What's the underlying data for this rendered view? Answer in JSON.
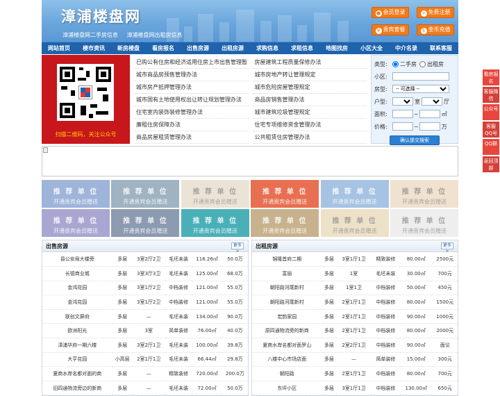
{
  "header": {
    "title": "漳浦楼盘网",
    "subtitles": [
      "漳浦楼盘网二手房信息",
      "漳浦楼盘网出租房信息"
    ],
    "buttons": [
      "会员登录",
      "免费注册",
      "贵宾套餐",
      "金币充值"
    ]
  },
  "nav": [
    "网站首页",
    "楼市资讯",
    "新房楼盘",
    "看房报名",
    "出售房源",
    "出租房源",
    "求购信息",
    "求租信息",
    "地图找房",
    "小区大全",
    "中介名录",
    "联系客服"
  ],
  "qr": {
    "caption": "扫描二维码，关注公众号"
  },
  "links": {
    "left": [
      "已购公有住房和经济适用住房上市出售管理暂",
      "城市商品房预售管理办法",
      "城市房产抵押管理办法",
      "城市国有土地使用权出让转让规划管理办法",
      "住宅室内装饰装修管理办法",
      "廉租住房保障办法",
      "商品房屋租赁管理办法"
    ],
    "right": [
      "房屋建筑工程质量保修办法",
      "城市房地产转让管理规定",
      "城市危险房屋管理规定",
      "商品房销售管理办法",
      "城市建筑垃圾管理规定",
      "住宅专项维修资金管理办法",
      "公共租赁住房管理办法"
    ]
  },
  "search": {
    "type_label": "类型:",
    "radio1": "二手房",
    "radio2": "出租房",
    "community_label": "小区:",
    "house_label": "房型:",
    "house_value": "-- 可选择 --",
    "layout_label": "户型:",
    "room_unit": "室",
    "hall_unit": "厅",
    "area_label": "面积:",
    "area_unit": "㎡",
    "price_label": "价格:",
    "price_unit": "万",
    "button": "确认提交搜索"
  },
  "promo": {
    "line1": "推 荐 单 位",
    "line2": "开通贵宾会员赠送",
    "colors": [
      "#9fb4d9",
      "#9fb3c2",
      "#ebe4d6",
      "#e86f51",
      "#a6c3e3",
      "#f0e2cf",
      "#a9a7d2",
      "#8d9bb1",
      "#4ab0b8",
      "#c8b28e",
      "#ede1c8",
      "#eeeeee"
    ]
  },
  "sale": {
    "title": "出售房源",
    "more": "更多>",
    "rows": [
      [
        "县公安局大楼旁",
        "多层",
        "3室2厅2卫",
        "毛坯未装",
        "116.26㎡",
        "50.0万"
      ],
      [
        "长德商业城",
        "多层",
        "3室3厅3卫",
        "毛坯未装",
        "125.00㎡",
        "68.0万"
      ],
      [
        "金鸿花园",
        "多层",
        "3室1厅2卫",
        "中档装修",
        "121.00㎡",
        "55.0万"
      ],
      [
        "金鸿花园",
        "多层",
        "3室1厅2卫",
        "中档装修",
        "121.00㎡",
        "55.0万"
      ],
      [
        "联创文屏府",
        "多层",
        "—",
        "毛坯未装",
        "134.00㎡",
        "90.0万"
      ],
      [
        "欧洲阳光",
        "多层",
        "3室",
        "简单装修",
        "76.00㎡",
        "40.0万"
      ],
      [
        "漳浦华府一期六楼",
        "多层",
        "3室2厅1卫",
        "毛坯未装",
        "100.00㎡",
        "39.8万"
      ],
      [
        "大亨花园",
        "小高层",
        "2室1厅1卫",
        "毛坯未装",
        "66.44㎡",
        "29.8万"
      ],
      [
        "夏商水岸名都对面的商",
        "多层",
        "—",
        "精致装修",
        "720.00㎡",
        "200.0万"
      ],
      [
        "旧四通物流旁边的新商",
        "多层",
        "—",
        "毛坯未装",
        "72.00㎡",
        "50.0万"
      ]
    ]
  },
  "rent": {
    "title": "出租房源",
    "more": "更多>",
    "rows": [
      [
        "锦隆首府二期",
        "多层",
        "3室1厅1卫",
        "精致装修",
        "80.00㎡",
        "2500元"
      ],
      [
        "富丽",
        "多层",
        "1室",
        "毛坯未装",
        "30.00㎡",
        "700元"
      ],
      [
        "朝阳路河尾新村",
        "多层",
        "1室1卫",
        "中档装修",
        "50.00㎡",
        "450元"
      ],
      [
        "朝阳路河尾新村",
        "多层",
        "2室1厅1卫",
        "中档装修",
        "80.00㎡",
        "1500元"
      ],
      [
        "宏韵家园",
        "多层",
        "2室1厅1卫",
        "中档装修",
        "90.00㎡",
        "1000元"
      ],
      [
        "原四通物流旁的新商",
        "多层",
        "2室1厅1卫",
        "中档装修",
        "80.00㎡",
        "2000元"
      ],
      [
        "夏商水岸名都对面罗山",
        "多层",
        "2室2厅1卫",
        "中档装修",
        "90.00㎡",
        "面议"
      ],
      [
        "八楼中心市场店面",
        "多层",
        "—",
        "简单装修",
        "15.00㎡",
        "300元"
      ],
      [
        "朝阳路",
        "多层",
        "2室1厅1卫",
        "中档装修",
        "80.00㎡",
        "700元"
      ],
      [
        "东坪小区",
        "多层",
        "3室1厅1卫",
        "中档装修",
        "130.00㎡",
        "650元"
      ]
    ]
  },
  "float": [
    "看房报名",
    "客服微信",
    "公众号",
    "客服QQ号",
    "QQ群",
    "返回顶部"
  ]
}
